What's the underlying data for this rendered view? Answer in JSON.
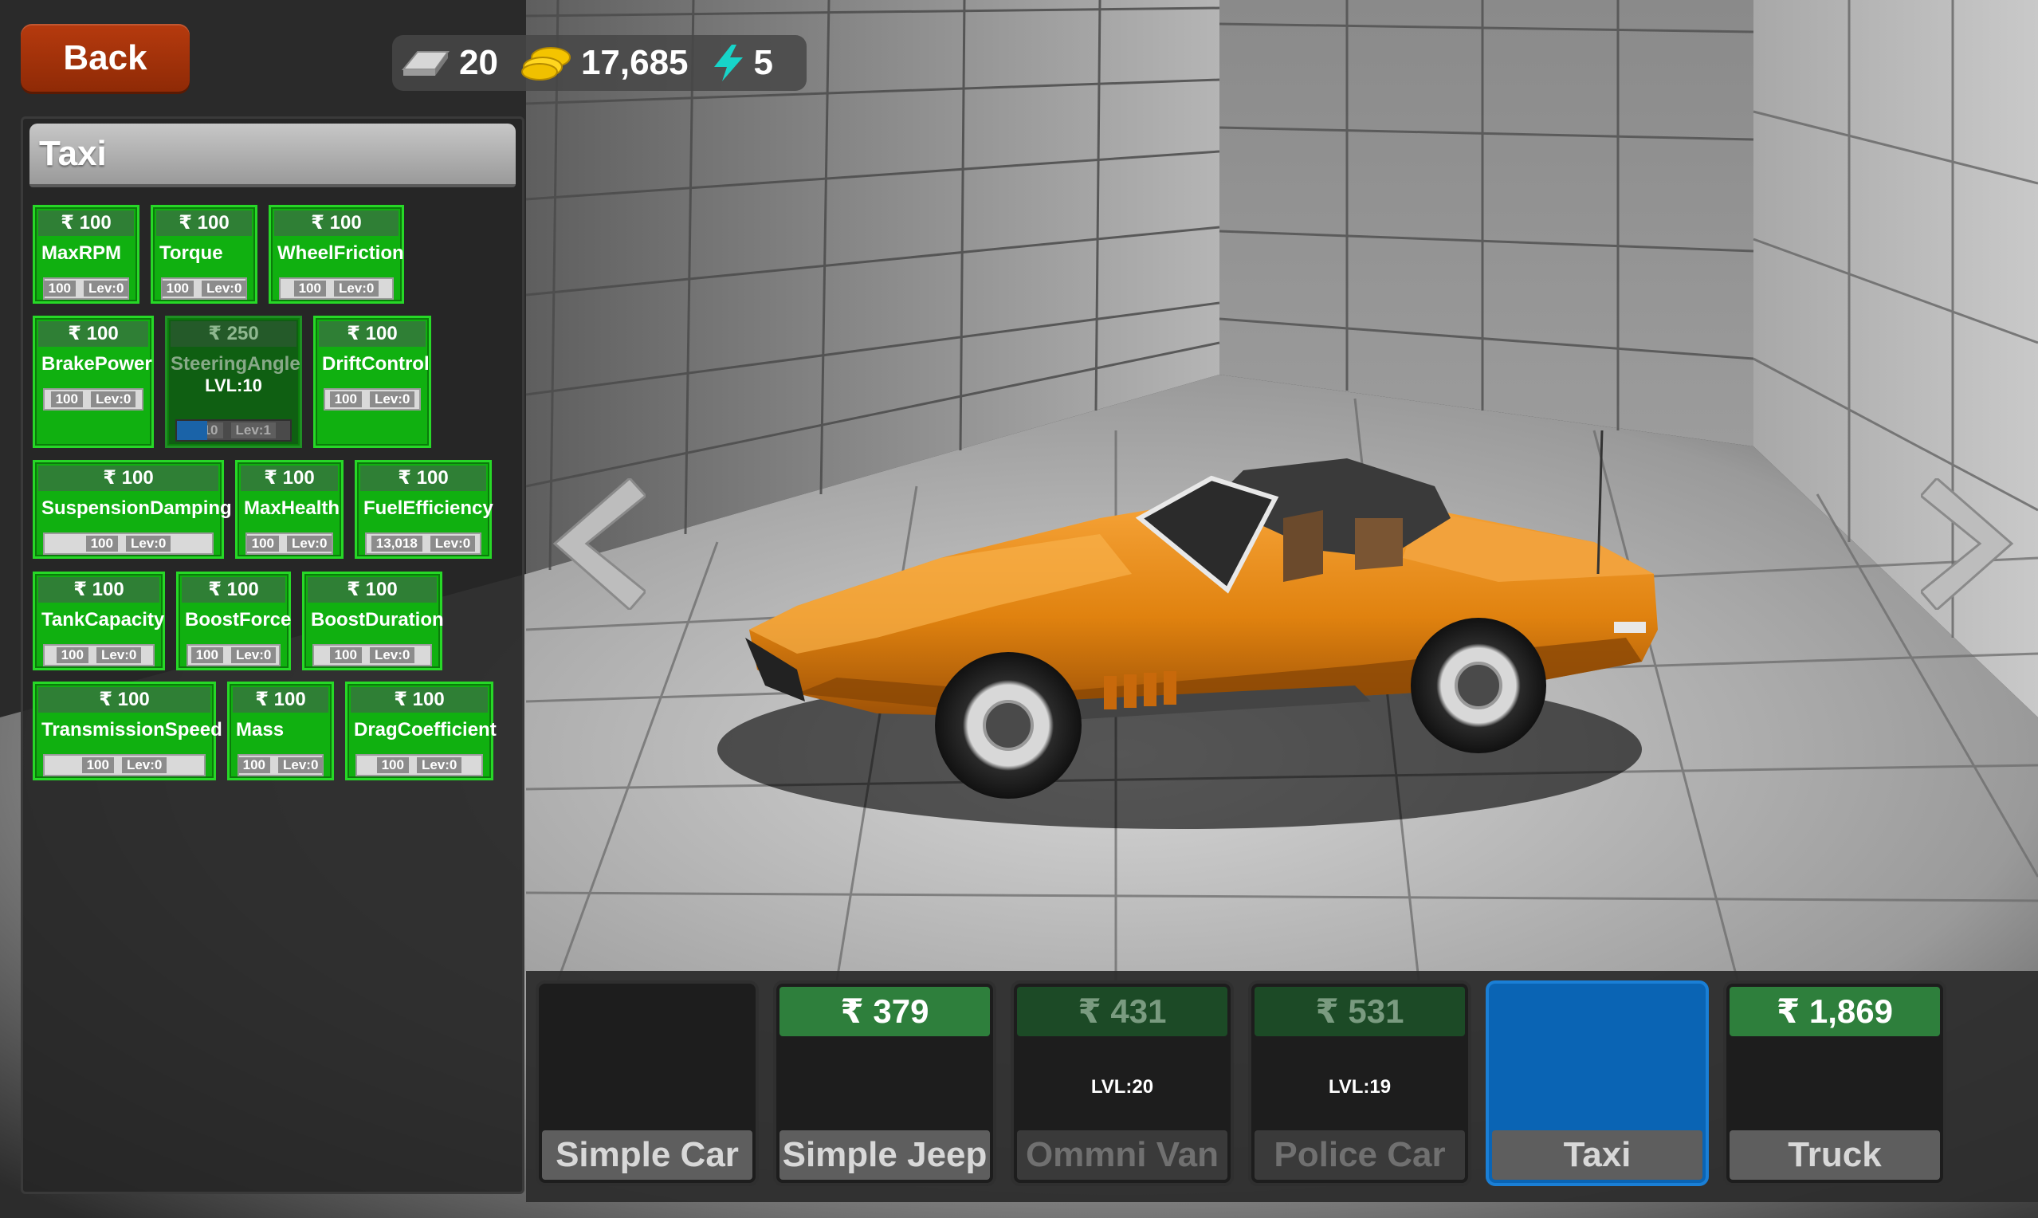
{
  "back_label": "Back",
  "currency": {
    "bars": "20",
    "coins": "17,685",
    "energy": "5"
  },
  "panel": {
    "title": "Taxi",
    "upgrades": [
      {
        "price": "₹ 100",
        "name": "MaxRPM",
        "value": "100",
        "level": "Lev:0"
      },
      {
        "price": "₹ 100",
        "name": "Torque",
        "value": "100",
        "level": "Lev:0"
      },
      {
        "price": "₹ 100",
        "name": "WheelFriction",
        "value": "100",
        "level": "Lev:0"
      },
      {
        "price": "₹ 100",
        "name": "BrakePower",
        "value": "100",
        "level": "Lev:0"
      },
      {
        "price": "₹ 250",
        "name": "SteeringAngle",
        "lvl_req": "LVL:10",
        "value": "110",
        "level": "Lev:1"
      },
      {
        "price": "₹ 100",
        "name": "DriftControl",
        "value": "100",
        "level": "Lev:0"
      },
      {
        "price": "₹ 100",
        "name": "SuspensionDamping",
        "value": "100",
        "level": "Lev:0"
      },
      {
        "price": "₹ 100",
        "name": "MaxHealth",
        "value": "100",
        "level": "Lev:0"
      },
      {
        "price": "₹ 100",
        "name": "FuelEfficiency",
        "value": "13,018",
        "level": "Lev:0"
      },
      {
        "price": "₹ 100",
        "name": "TankCapacity",
        "value": "100",
        "level": "Lev:0"
      },
      {
        "price": "₹ 100",
        "name": "BoostForce",
        "value": "100",
        "level": "Lev:0"
      },
      {
        "price": "₹ 100",
        "name": "BoostDuration",
        "value": "100",
        "level": "Lev:0"
      },
      {
        "price": "₹ 100",
        "name": "TransmissionSpeed",
        "value": "100",
        "level": "Lev:0"
      },
      {
        "price": "₹ 100",
        "name": "Mass",
        "value": "100",
        "level": "Lev:0"
      },
      {
        "price": "₹ 100",
        "name": "DragCoefficient",
        "value": "100",
        "level": "Lev:0"
      }
    ]
  },
  "vehicles": [
    {
      "name": "Simple Car",
      "price": "",
      "lvl": ""
    },
    {
      "name": "Simple Jeep",
      "price": "₹ 379",
      "lvl": ""
    },
    {
      "name": "Ommni Van",
      "price": "₹ 431",
      "lvl": "LVL:20"
    },
    {
      "name": "Police Car",
      "price": "₹ 531",
      "lvl": "LVL:19"
    },
    {
      "name": "Taxi",
      "price": "",
      "lvl": ""
    },
    {
      "name": "Truck",
      "price": "₹ 1,869",
      "lvl": ""
    }
  ],
  "colors": {
    "upgrade_green": "#10b010",
    "selected_blue": "#0a64b4",
    "back_red": "#a6350b",
    "car_orange": "#e98a12"
  },
  "icons": [
    "silver-bar-icon",
    "gold-coins-icon",
    "lightning-icon",
    "arrow-left-icon",
    "arrow-right-icon"
  ]
}
